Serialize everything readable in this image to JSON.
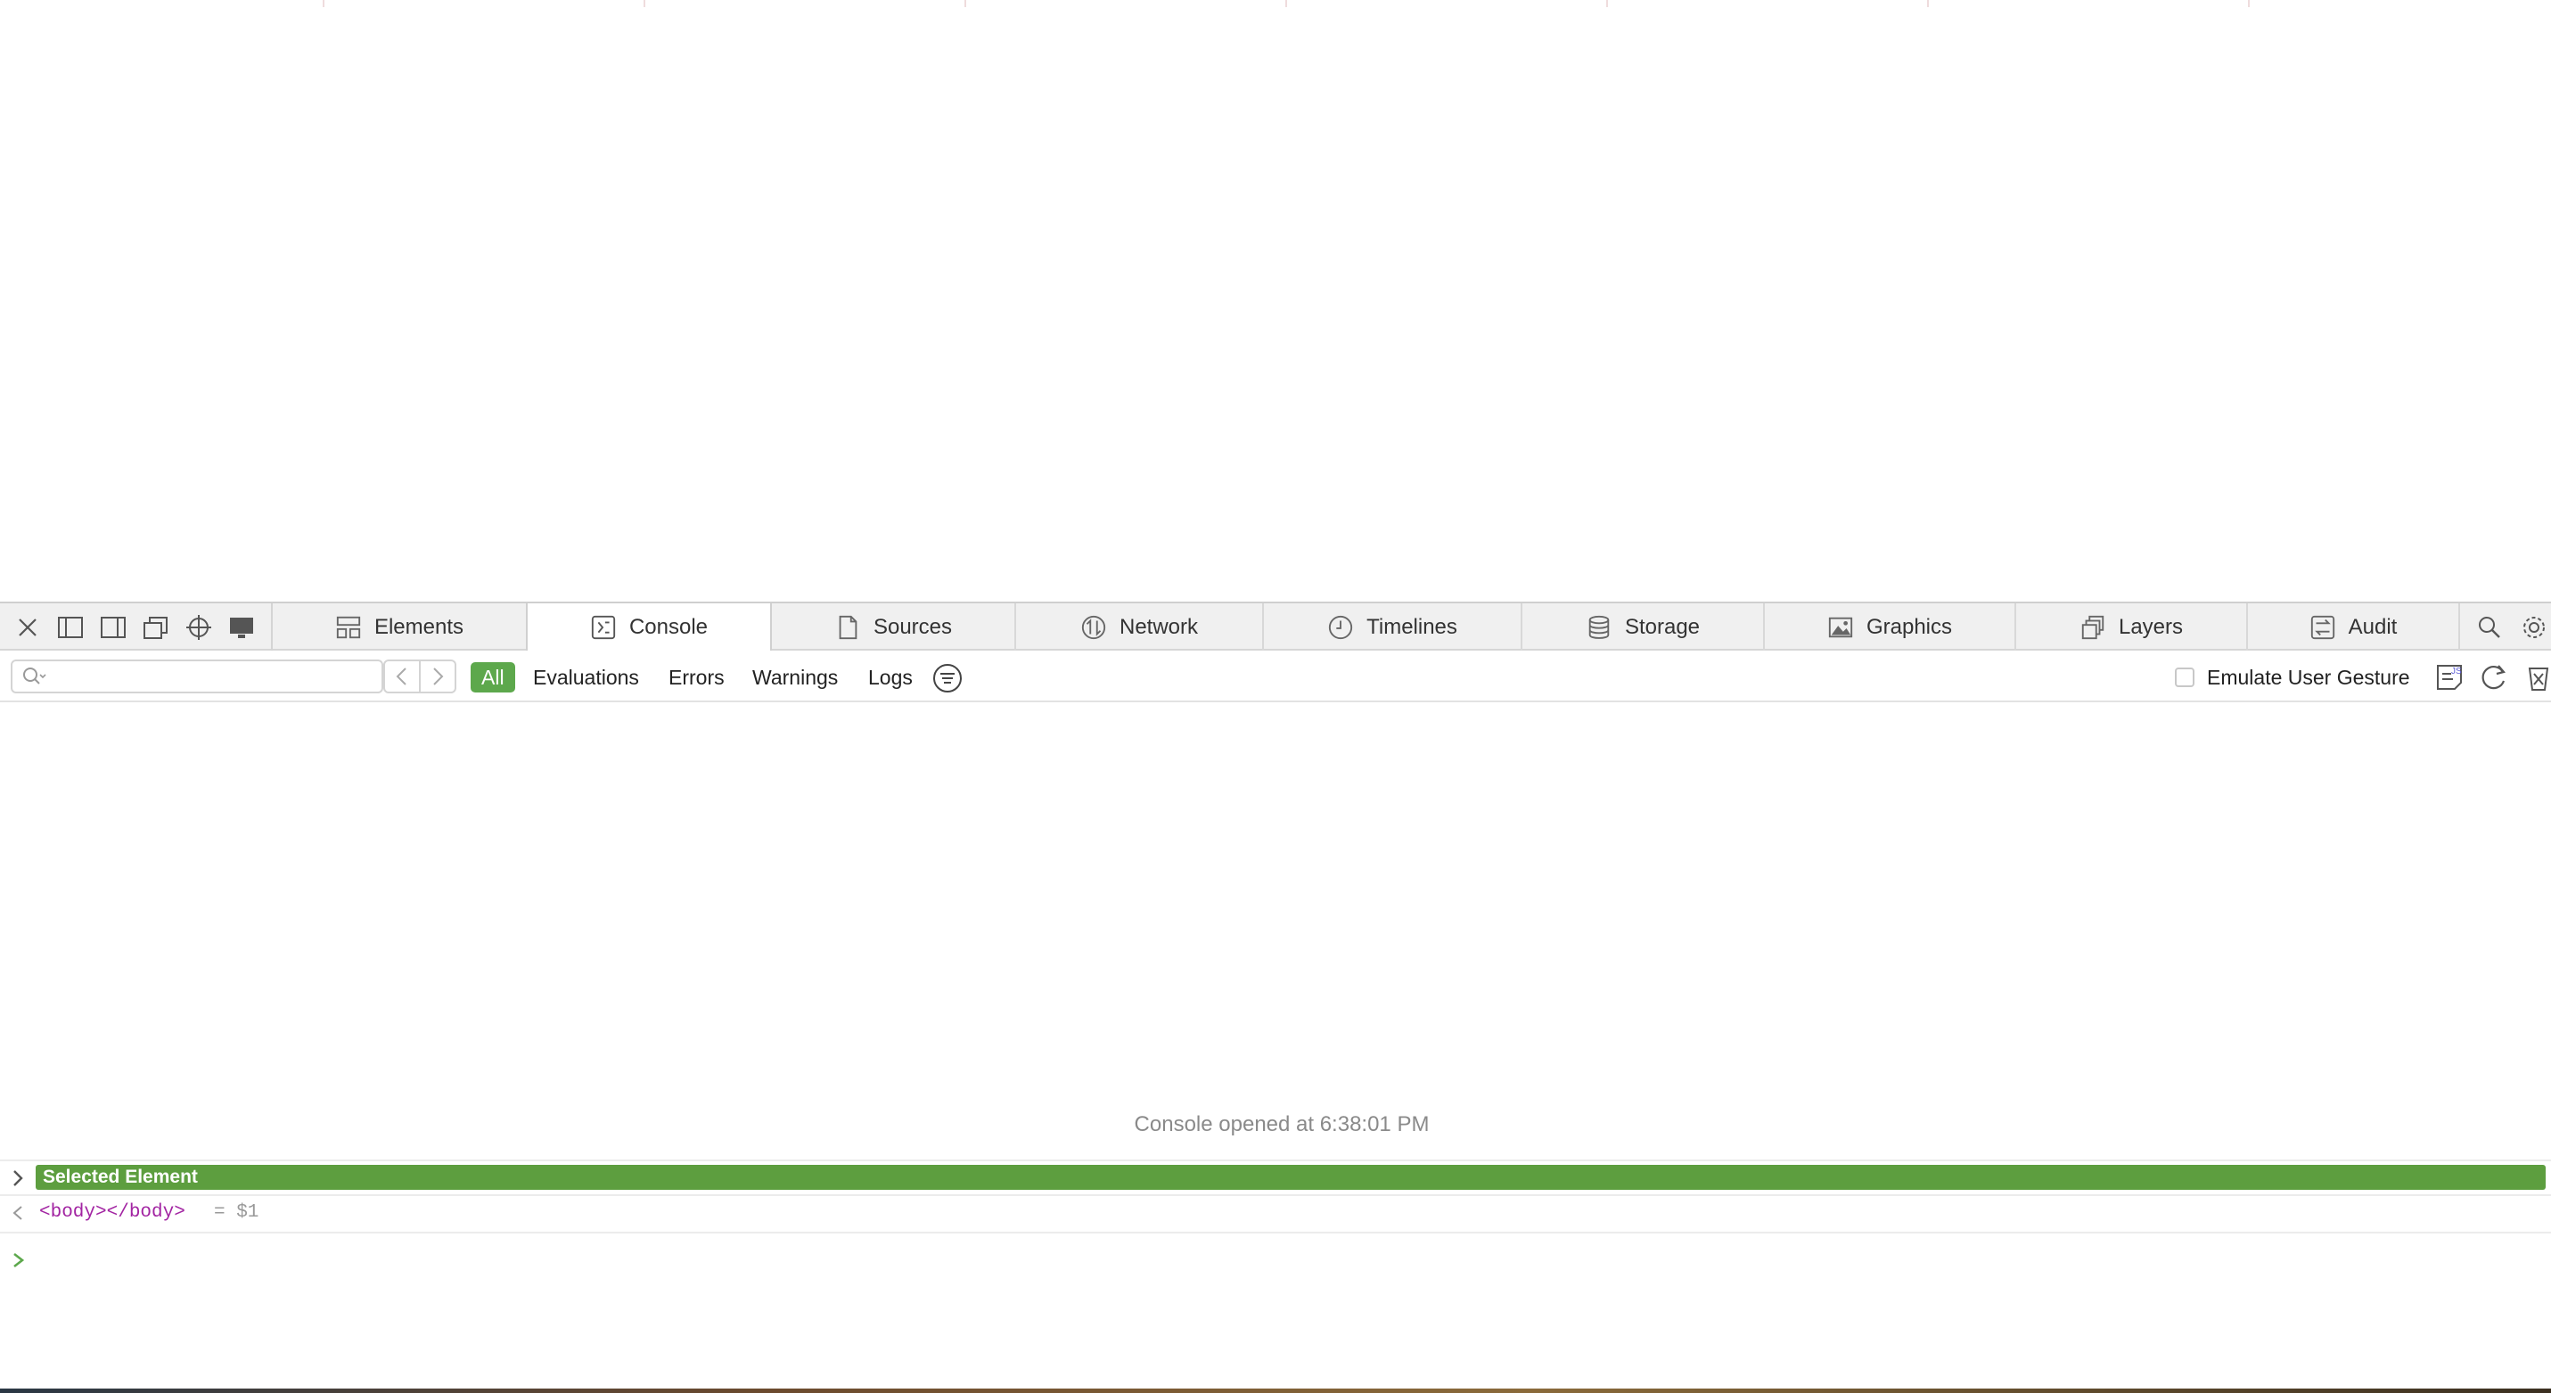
{
  "tabs": [
    {
      "label": "Elements",
      "icon": "elements-icon"
    },
    {
      "label": "Console",
      "icon": "console-icon",
      "active": true
    },
    {
      "label": "Sources",
      "icon": "sources-icon"
    },
    {
      "label": "Network",
      "icon": "network-icon"
    },
    {
      "label": "Timelines",
      "icon": "timelines-icon"
    },
    {
      "label": "Storage",
      "icon": "storage-icon"
    },
    {
      "label": "Graphics",
      "icon": "graphics-icon"
    },
    {
      "label": "Layers",
      "icon": "layers-icon"
    },
    {
      "label": "Audit",
      "icon": "audit-icon"
    }
  ],
  "filter": {
    "search_value": "",
    "levels": [
      "All",
      "Evaluations",
      "Errors",
      "Warnings",
      "Logs"
    ],
    "active_level": "All",
    "emulate_label": "Emulate User Gesture",
    "emulate_checked": false
  },
  "console": {
    "opened_message": "Console opened at 6:38:01 PM",
    "group_label": "Selected Element",
    "result_tag": "<body></body>",
    "result_ref": "= $1"
  },
  "colors": {
    "accent": "#5da84c",
    "group_bar": "#5d9e3f",
    "tag": "#a224a2"
  }
}
